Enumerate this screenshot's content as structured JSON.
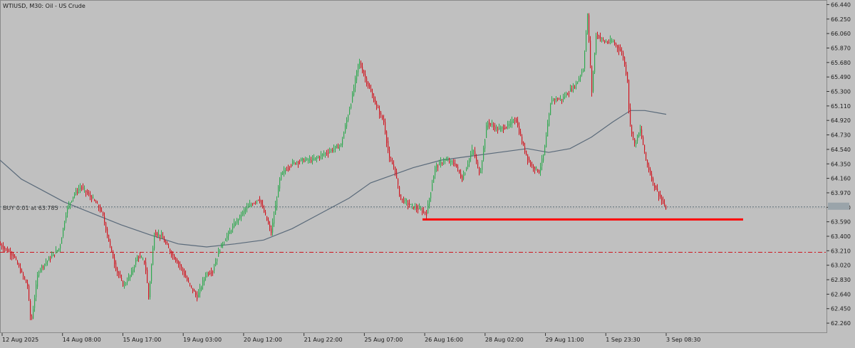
{
  "header": {
    "title": "WTIUSD, M30:  Oil - US Crude"
  },
  "colors": {
    "background": "#c0c0c0",
    "bull": "#2fa84f",
    "bear": "#d0141e",
    "ma": "#5a6a7a",
    "support_line": "#ff0000",
    "order_line": "#5d6f79",
    "price_line_marker": "#a8a8a8",
    "sl_line": "#d0141e"
  },
  "trade": {
    "label": "BUY 0.01 at 63.785",
    "price": 63.785
  },
  "levels": {
    "stop_line_price": 63.19,
    "support_price": 63.62,
    "current_price": 63.77
  },
  "chart_data": {
    "type": "candlestick",
    "symbol": "WTIUSD",
    "timeframe": "M30",
    "instrument": "Oil - US Crude",
    "ylim": [
      62.13,
      66.5
    ],
    "y_ticks": [
      "66.440",
      "66.250",
      "66.060",
      "65.870",
      "65.680",
      "65.490",
      "65.300",
      "65.110",
      "64.920",
      "64.730",
      "64.540",
      "64.350",
      "64.160",
      "63.970",
      "63.780",
      "63.590",
      "63.400",
      "63.210",
      "63.020",
      "62.830",
      "62.640",
      "62.450",
      "62.260"
    ],
    "x_tick_labels": [
      "12 Aug 2025",
      "14 Aug 08:00",
      "15 Aug 17:00",
      "19 Aug 03:00",
      "20 Aug 12:00",
      "21 Aug 22:00",
      "25 Aug 07:00",
      "26 Aug 16:00",
      "28 Aug 02:00",
      "29 Aug 11:00",
      "1 Sep 23:30",
      "3 Sep 08:30"
    ],
    "price_path": [
      [
        0,
        63.3
      ],
      [
        20,
        63.15
      ],
      [
        30,
        62.95
      ],
      [
        40,
        62.75
      ],
      [
        45,
        62.25
      ],
      [
        55,
        62.95
      ],
      [
        70,
        63.1
      ],
      [
        85,
        63.25
      ],
      [
        95,
        63.75
      ],
      [
        105,
        63.95
      ],
      [
        115,
        64.05
      ],
      [
        125,
        63.95
      ],
      [
        135,
        63.85
      ],
      [
        145,
        63.7
      ],
      [
        155,
        63.3
      ],
      [
        165,
        62.95
      ],
      [
        175,
        62.75
      ],
      [
        185,
        62.9
      ],
      [
        195,
        63.15
      ],
      [
        205,
        63.05
      ],
      [
        210,
        62.6
      ],
      [
        218,
        63.45
      ],
      [
        228,
        63.4
      ],
      [
        240,
        63.2
      ],
      [
        255,
        63.0
      ],
      [
        265,
        62.8
      ],
      [
        278,
        62.6
      ],
      [
        290,
        62.9
      ],
      [
        300,
        62.95
      ],
      [
        310,
        63.25
      ],
      [
        320,
        63.4
      ],
      [
        330,
        63.55
      ],
      [
        345,
        63.75
      ],
      [
        365,
        63.9
      ],
      [
        382,
        63.45
      ],
      [
        395,
        64.2
      ],
      [
        410,
        64.35
      ],
      [
        425,
        64.4
      ],
      [
        440,
        64.4
      ],
      [
        460,
        64.5
      ],
      [
        480,
        64.6
      ],
      [
        495,
        65.2
      ],
      [
        505,
        65.7
      ],
      [
        515,
        65.45
      ],
      [
        530,
        65.1
      ],
      [
        540,
        64.9
      ],
      [
        548,
        64.4
      ],
      [
        555,
        64.3
      ],
      [
        563,
        63.9
      ],
      [
        578,
        63.8
      ],
      [
        590,
        63.75
      ],
      [
        600,
        63.7
      ],
      [
        612,
        64.3
      ],
      [
        625,
        64.4
      ],
      [
        640,
        64.35
      ],
      [
        650,
        64.15
      ],
      [
        665,
        64.55
      ],
      [
        675,
        64.2
      ],
      [
        685,
        64.9
      ],
      [
        700,
        64.8
      ],
      [
        715,
        64.85
      ],
      [
        725,
        64.95
      ],
      [
        735,
        64.6
      ],
      [
        745,
        64.35
      ],
      [
        758,
        64.25
      ],
      [
        765,
        64.5
      ],
      [
        775,
        65.2
      ],
      [
        790,
        65.2
      ],
      [
        800,
        65.3
      ],
      [
        810,
        65.4
      ],
      [
        820,
        65.6
      ],
      [
        826,
        66.3
      ],
      [
        832,
        65.3
      ],
      [
        838,
        66.05
      ],
      [
        850,
        65.95
      ],
      [
        862,
        65.95
      ],
      [
        875,
        65.8
      ],
      [
        882,
        65.45
      ],
      [
        885,
        64.9
      ],
      [
        892,
        64.6
      ],
      [
        900,
        64.8
      ],
      [
        908,
        64.4
      ],
      [
        918,
        64.1
      ],
      [
        926,
        63.95
      ],
      [
        935,
        63.77
      ]
    ],
    "ma_path": [
      [
        0,
        64.4
      ],
      [
        30,
        64.15
      ],
      [
        60,
        64.0
      ],
      [
        90,
        63.85
      ],
      [
        130,
        63.7
      ],
      [
        170,
        63.55
      ],
      [
        210,
        63.42
      ],
      [
        250,
        63.3
      ],
      [
        290,
        63.26
      ],
      [
        330,
        63.3
      ],
      [
        370,
        63.35
      ],
      [
        410,
        63.5
      ],
      [
        450,
        63.7
      ],
      [
        490,
        63.9
      ],
      [
        520,
        64.1
      ],
      [
        550,
        64.2
      ],
      [
        580,
        64.3
      ],
      [
        620,
        64.4
      ],
      [
        660,
        64.45
      ],
      [
        700,
        64.5
      ],
      [
        740,
        64.55
      ],
      [
        770,
        64.5
      ],
      [
        800,
        64.55
      ],
      [
        830,
        64.7
      ],
      [
        860,
        64.9
      ],
      [
        885,
        65.05
      ],
      [
        905,
        65.05
      ],
      [
        935,
        65.0
      ]
    ]
  }
}
